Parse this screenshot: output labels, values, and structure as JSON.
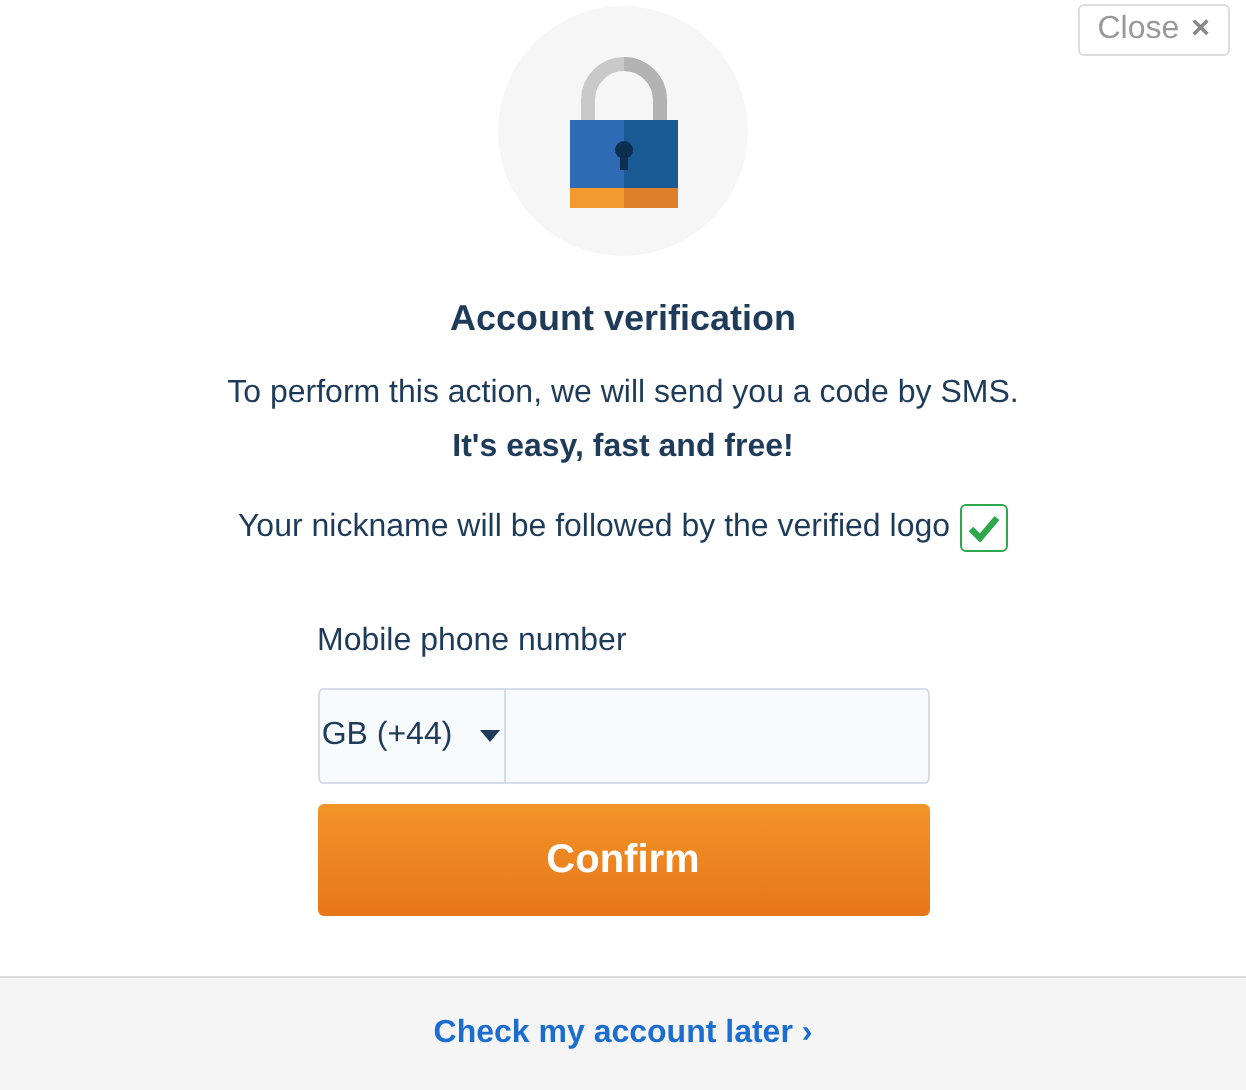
{
  "close_button": {
    "label": "Close",
    "icon": "×"
  },
  "title": "Account verification",
  "description": "To perform this action, we will send you a code by SMS.",
  "tagline": "It's easy, fast and free!",
  "verified_note": {
    "text": "Your nickname will be followed by the verified logo",
    "checked": true
  },
  "phone": {
    "label": "Mobile phone number",
    "country": "GB (+44)"
  },
  "confirm_button": "Confirm",
  "footer_link": {
    "label": "Check my account later",
    "chevron": "›"
  }
}
